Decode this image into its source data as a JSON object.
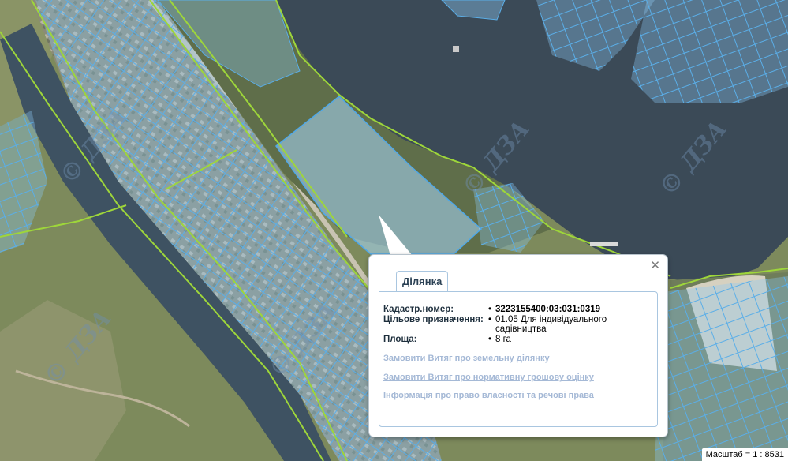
{
  "map": {
    "watermark": "© ДЗА",
    "colors": {
      "river": "#3b4a57",
      "channel": "#3e5262",
      "land": "#7d8a5c",
      "parcel_fill": "#8cc8f2",
      "parcel_stroke": "#5aaee8",
      "boundary": "#9ed63a"
    }
  },
  "popup": {
    "tab_label": "Ділянка",
    "close_glyph": "✕",
    "fields": [
      {
        "label": "Кадастр.номер:",
        "value": "3223155400:03:031:0319"
      },
      {
        "label": "Цільове призначення:",
        "value": "01.05 Для індивідуального садівництва"
      },
      {
        "label": "Площа:",
        "value": "8 га"
      }
    ],
    "links": [
      "Замовити Витяг про земельну ділянку",
      "Замовити Витяг про нормативну грошову оцінку",
      "Інформація про право власності та речові права"
    ]
  },
  "scale": {
    "text": "Масштаб = 1 : 8531"
  }
}
